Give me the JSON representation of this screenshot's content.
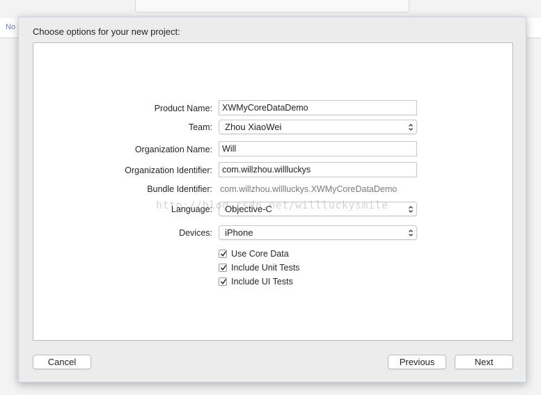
{
  "background": {
    "left_label": "No"
  },
  "sheet": {
    "title": "Choose options for your new project:"
  },
  "form": {
    "product_name": {
      "label": "Product Name:",
      "value": "XWMyCoreDataDemo"
    },
    "team": {
      "label": "Team:",
      "value": "Zhou XiaoWei"
    },
    "organization_name": {
      "label": "Organization Name:",
      "value": "Will"
    },
    "organization_identifier": {
      "label": "Organization Identifier:",
      "value": "com.willzhou.willluckys"
    },
    "bundle_identifier": {
      "label": "Bundle Identifier:",
      "value": "com.willzhou.willluckys.XWMyCoreDataDemo"
    },
    "language": {
      "label": "Language:",
      "value": "Objective-C"
    },
    "devices": {
      "label": "Devices:",
      "value": "iPhone"
    },
    "checkboxes": [
      {
        "label": "Use Core Data",
        "checked": true
      },
      {
        "label": "Include Unit Tests",
        "checked": true
      },
      {
        "label": "Include UI Tests",
        "checked": true
      }
    ]
  },
  "watermark": "http://blog.csdn.net/willluckysmile",
  "buttons": {
    "cancel": "Cancel",
    "previous": "Previous",
    "next": "Next"
  }
}
